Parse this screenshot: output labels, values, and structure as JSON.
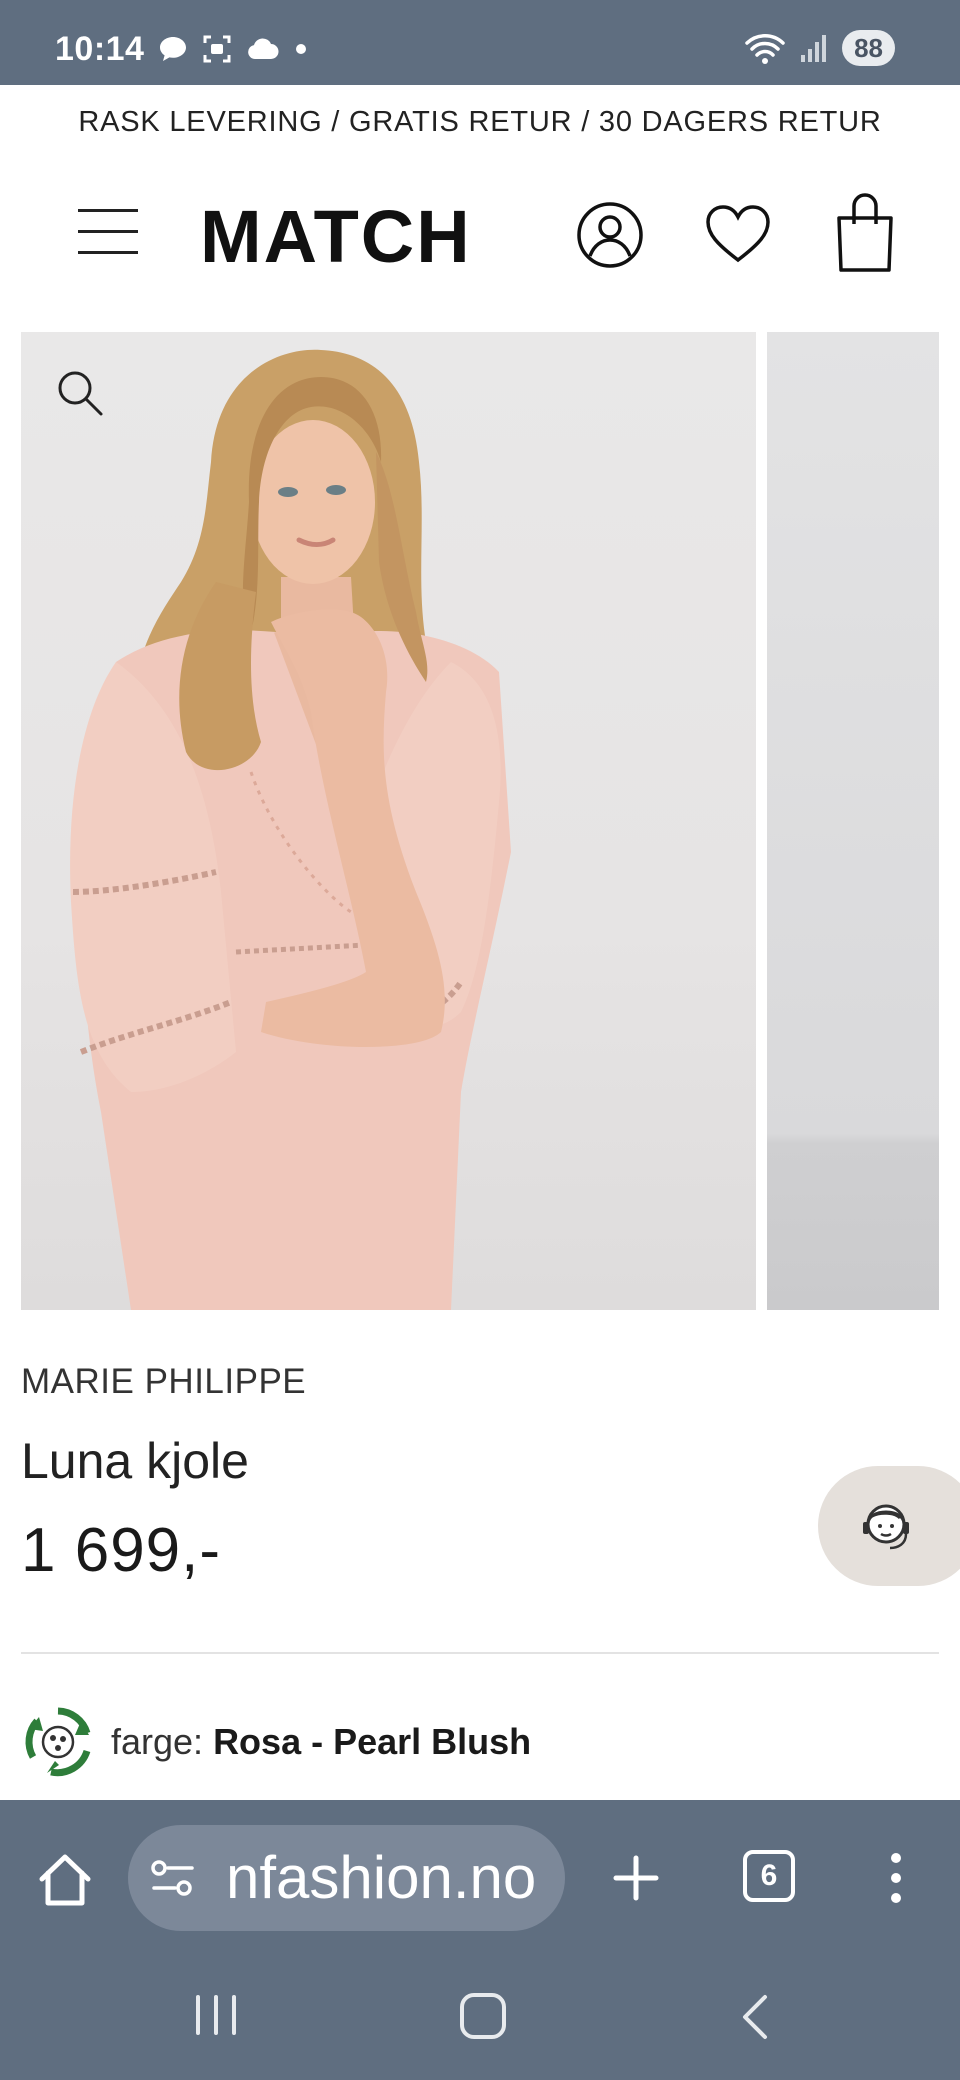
{
  "status_bar": {
    "time": "10:14",
    "battery": "88",
    "icons_left": [
      "chat-bubble-icon",
      "screenshot-icon",
      "cloud-icon",
      "dot-icon"
    ],
    "icons_right": [
      "wifi-icon",
      "signal-icon",
      "battery-icon"
    ]
  },
  "promo_banner": {
    "text": "RASK LEVERING / GRATIS RETUR / 30 DAGERS RETUR"
  },
  "header": {
    "logo": "MATCH",
    "icons": [
      "menu-icon",
      "account-icon",
      "wishlist-heart-icon",
      "shopping-bag-icon"
    ]
  },
  "product": {
    "brand": "MARIE PHILIPPE",
    "name": "Luna kjole",
    "price": "1 699,-",
    "color_label": "farge:",
    "color_value": "Rosa - Pearl Blush",
    "image_description": "Woman with long blonde wavy hair wearing a pale pink embroidered dress"
  },
  "chat": {
    "icon": "customer-service-icon"
  },
  "browser": {
    "url": "nfashion.no",
    "tab_count": "6",
    "icons": [
      "home-icon",
      "site-settings-icon",
      "plus-icon",
      "tabs-icon",
      "more-vert-icon"
    ]
  },
  "nav_bar": {
    "icons": [
      "recents-icon",
      "home-nav-icon",
      "back-icon"
    ]
  },
  "colors": {
    "system_bar": "#5f6e80",
    "url_pill": "#7c8899",
    "chat_bubble": "#e5e0db",
    "eco_green": "#2e7d3a",
    "dress_pink": "#f0c8bc"
  }
}
